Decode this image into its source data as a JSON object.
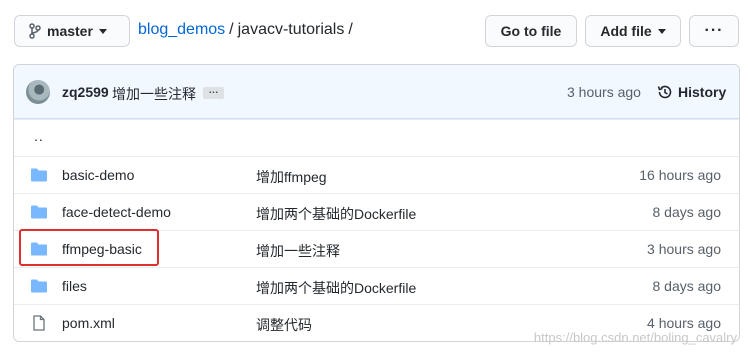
{
  "toolbar": {
    "branch": "master",
    "goto_file": "Go to file",
    "add_file": "Add file",
    "more": "···"
  },
  "breadcrumb": {
    "repo": "blog_demos",
    "sep1": "/",
    "folder": "javacv-tutorials",
    "sep2": "/"
  },
  "commit": {
    "author": "zq2599",
    "message": "增加一些注释",
    "ellipsis": "…",
    "time": "3 hours ago",
    "history_label": "History"
  },
  "parent_dir": "..",
  "files": [
    {
      "name": "basic-demo",
      "type": "folder",
      "message": "增加ffmpeg",
      "age": "16 hours ago"
    },
    {
      "name": "face-detect-demo",
      "type": "folder",
      "message": "增加两个基础的Dockerfile",
      "age": "8 days ago"
    },
    {
      "name": "ffmpeg-basic",
      "type": "folder",
      "message": "增加一些注释",
      "age": "3 hours ago"
    },
    {
      "name": "files",
      "type": "folder",
      "message": "增加两个基础的Dockerfile",
      "age": "8 days ago"
    },
    {
      "name": "pom.xml",
      "type": "file",
      "message": "调整代码",
      "age": "4 hours ago"
    }
  ],
  "watermark": "https://blog.csdn.net/boling_cavalry",
  "colors": {
    "link": "#0366d6",
    "folder_icon": "#79b8ff",
    "highlight": "#e0302e",
    "commit_bar": "#f1f8ff"
  }
}
